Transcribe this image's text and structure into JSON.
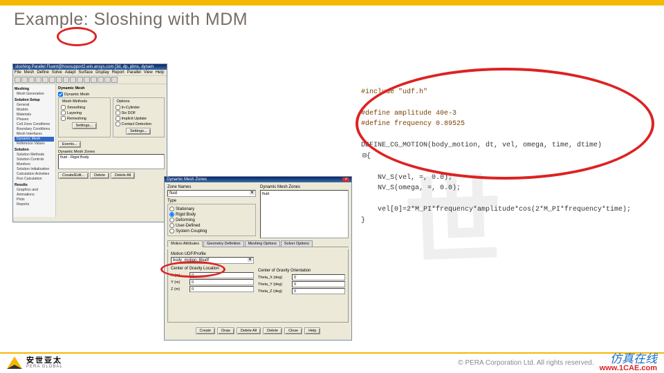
{
  "slide_title": "Example: Sloshing with MDM",
  "win1": {
    "title": "sloshing Parallel Fluent@housupport2.win.ansys.com [3d, dp, pbns, dynam",
    "menus": [
      "File",
      "Mesh",
      "Define",
      "Solve",
      "Adapt",
      "Surface",
      "Display",
      "Report",
      "Parallel",
      "View",
      "Help"
    ],
    "tree": {
      "sections": [
        {
          "header": "Meshing",
          "items": [
            "Mesh Generation"
          ]
        },
        {
          "header": "Solution Setup",
          "items": [
            "General",
            "Models",
            "Materials",
            "Phases",
            "Cell Zone Conditions",
            "Boundary Conditions",
            "Mesh Interfaces",
            "Dynamic Mesh",
            "Reference Values"
          ],
          "selected": "Dynamic Mesh"
        },
        {
          "header": "Solution",
          "items": [
            "Solution Methods",
            "Solution Controls",
            "Monitors",
            "Solution Initialization",
            "Calculation Activities",
            "Run Calculation"
          ]
        },
        {
          "header": "Results",
          "items": [
            "Graphics and Animations",
            "Plots",
            "Reports"
          ]
        }
      ]
    },
    "panel": {
      "title": "Dynamic Mesh",
      "dyn_mesh": "Dynamic Mesh",
      "mesh_methods_label": "Mesh Methods",
      "mesh_methods": [
        "Smoothing",
        "Layering",
        "Remeshing"
      ],
      "options_label": "Options",
      "options": [
        "In-Cylinder",
        "Six DOF",
        "Implicit Update",
        "Contact Detection"
      ],
      "settings": "Settings...",
      "events": "Events...",
      "dmz_label": "Dynamic Mesh Zones",
      "dmz_item": "fluid - Rigid Body",
      "buttons": [
        "Create/Edit...",
        "Delete",
        "Delete All"
      ]
    }
  },
  "win2": {
    "title": "Dynamic Mesh Zones",
    "zone_names_label": "Zone Names",
    "zone_names_value": "fluid",
    "dmz_label": "Dynamic Mesh Zones",
    "dmz_item": "fluid",
    "type_label": "Type",
    "types": [
      "Stationary",
      "Rigid Body",
      "Deforming",
      "User-Defined",
      "System Coupling"
    ],
    "type_selected": "Rigid Body",
    "tabs": [
      "Motion Attributes",
      "Geometry Definition",
      "Meshing Options",
      "Solver Options"
    ],
    "motion_label": "Motion UDF/Profile",
    "motion_value": "body_motion::libudf",
    "cg_loc_label": "Center of Gravity Location",
    "cg_loc": [
      {
        "l": "X (m)",
        "v": "0"
      },
      {
        "l": "Y (m)",
        "v": "0"
      },
      {
        "l": "Z (m)",
        "v": "0"
      }
    ],
    "cg_ori_label": "Center of Gravity Orientation",
    "cg_ori": [
      {
        "l": "Theta_X (deg)",
        "v": "0"
      },
      {
        "l": "Theta_Y (deg)",
        "v": "0"
      },
      {
        "l": "Theta_Z (deg)",
        "v": "0"
      }
    ],
    "buttons": [
      "Create",
      "Draw",
      "Delete All",
      "Delete",
      "Close",
      "Help"
    ]
  },
  "code": {
    "include": "#include \"udf.h\"",
    "def_amp": "#define amplitude 40e-3",
    "def_freq": "#define frequency 0.89525",
    "macro": "DEFINE_CG_MOTION(body_motion, dt, vel, omega, time, dtime)",
    "brace_open": "{",
    "nv1": "    NV_S(vel, =, 0.0);",
    "nv2": "    NV_S(omega, =, 0.0);",
    "vel": "    vel[0]=2*M_PI*frequency*amplitude*cos(2*M_PI*frequency*time);",
    "brace_close": "}"
  },
  "footer": {
    "logo_cn": "安世亚太",
    "logo_en": "PERA GLOBAL",
    "copyright": "© PERA Corporation Ltd. All rights reserved.",
    "cae_cn": "仿真在线",
    "cae_url": "www.1CAE.com"
  },
  "watermark": "世"
}
